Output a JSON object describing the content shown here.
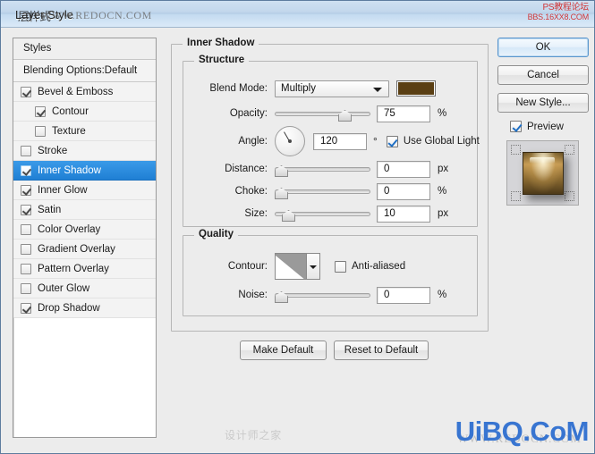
{
  "window": {
    "title": "Layer Style",
    "watermark_title_cn": "层样式",
    "watermark_redocn": "WWW.REDOCN.COM",
    "watermark_red_line1": "PS教程论坛",
    "watermark_red_line2": "BBS.16XX8.COM",
    "watermark_uibq": "UiBQ.CoM",
    "watermark_bottom_gray": "WWW.REDOCN.COM",
    "watermark_mid_gray": "设计师之家"
  },
  "styles_panel": {
    "header": "Styles",
    "blending_options": "Blending Options:Default",
    "items": [
      {
        "label": "Bevel & Emboss",
        "checked": true,
        "indent": false,
        "selected": false
      },
      {
        "label": "Contour",
        "checked": true,
        "indent": true,
        "selected": false
      },
      {
        "label": "Texture",
        "checked": false,
        "indent": true,
        "selected": false
      },
      {
        "label": "Stroke",
        "checked": false,
        "indent": false,
        "selected": false
      },
      {
        "label": "Inner Shadow",
        "checked": true,
        "indent": false,
        "selected": true
      },
      {
        "label": "Inner Glow",
        "checked": true,
        "indent": false,
        "selected": false
      },
      {
        "label": "Satin",
        "checked": true,
        "indent": false,
        "selected": false
      },
      {
        "label": "Color Overlay",
        "checked": false,
        "indent": false,
        "selected": false
      },
      {
        "label": "Gradient Overlay",
        "checked": false,
        "indent": false,
        "selected": false
      },
      {
        "label": "Pattern Overlay",
        "checked": false,
        "indent": false,
        "selected": false
      },
      {
        "label": "Outer Glow",
        "checked": false,
        "indent": false,
        "selected": false
      },
      {
        "label": "Drop Shadow",
        "checked": true,
        "indent": false,
        "selected": false
      }
    ]
  },
  "panel": {
    "title": "Inner Shadow",
    "structure": {
      "legend": "Structure",
      "blend_mode_label": "Blend Mode:",
      "blend_mode_value": "Multiply",
      "shadow_color": "#5a3f14",
      "opacity_label": "Opacity:",
      "opacity_value": "75",
      "opacity_unit": "%",
      "opacity_percent": 75,
      "angle_label": "Angle:",
      "angle_value": "120",
      "angle_unit": "°",
      "use_global_light_label": "Use Global Light",
      "use_global_light_checked": true,
      "distance_label": "Distance:",
      "distance_value": "0",
      "distance_unit": "px",
      "distance_percent": 0,
      "choke_label": "Choke:",
      "choke_value": "0",
      "choke_unit": "%",
      "choke_percent": 0,
      "size_label": "Size:",
      "size_value": "10",
      "size_unit": "px",
      "size_percent": 8
    },
    "quality": {
      "legend": "Quality",
      "contour_label": "Contour:",
      "anti_aliased_label": "Anti-aliased",
      "anti_aliased_checked": false,
      "noise_label": "Noise:",
      "noise_value": "0",
      "noise_unit": "%",
      "noise_percent": 0
    },
    "make_default": "Make Default",
    "reset_to_default": "Reset to Default"
  },
  "actions": {
    "ok": "OK",
    "cancel": "Cancel",
    "new_style": "New Style...",
    "preview_label": "Preview",
    "preview_checked": true
  },
  "colors": {
    "accent_selection": "#2f8de4",
    "dialog_bg": "#ececec",
    "titlebar_blue": "#c2d7ec",
    "watermark_red": "#d22a2a",
    "watermark_blue": "#2f6fd0"
  }
}
